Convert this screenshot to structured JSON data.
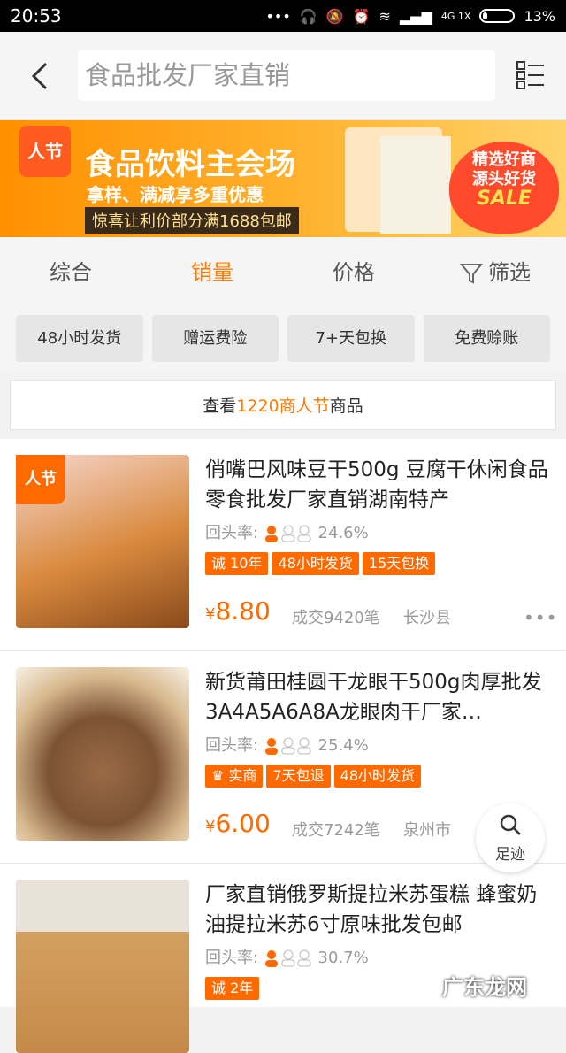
{
  "statusbar": {
    "time": "20:53",
    "signal_text": "4G 1X",
    "battery": "13%"
  },
  "header": {
    "search_placeholder": "食品批发厂家直销"
  },
  "banner": {
    "logo": "人节",
    "title": "食品饮料主会场",
    "subtitle": "拿样、满减享多重优惠",
    "promo": "惊喜让利价部分满1688包邮",
    "badge_line1": "精选好商",
    "badge_line2": "源头好货",
    "badge_sale": "SALE"
  },
  "tabs": [
    {
      "label": "综合",
      "active": false
    },
    {
      "label": "销量",
      "active": true
    },
    {
      "label": "价格",
      "active": false
    },
    {
      "label": "筛选",
      "active": false
    }
  ],
  "filters": [
    "48小时发货",
    "赠运费险",
    "7+天包换",
    "免费赊账"
  ],
  "notice": {
    "prefix": "查看",
    "highlight": "1220商人节",
    "suffix": "商品"
  },
  "products": [
    {
      "ribbon": "人节",
      "title": "俏嘴巴风味豆干500g 豆腐干休闲食品零食批发厂家直销湖南特产",
      "repeat_label": "回头率:",
      "repeat_rate": "24.6%",
      "tags": [
        "诚 10年",
        "48小时发货",
        "15天包换"
      ],
      "price": "8.80",
      "deals": "成交9420笔",
      "region": "长沙县"
    },
    {
      "ribbon": "",
      "title": "新货莆田桂圆干龙眼干500g肉厚批发3A4A5A6A8A龙眼肉干厂家…",
      "repeat_label": "回头率:",
      "repeat_rate": "25.4%",
      "tags": [
        "实商",
        "7天包退",
        "48小时发货"
      ],
      "price": "6.00",
      "deals": "成交7242笔",
      "region": "泉州市"
    },
    {
      "ribbon": "",
      "title": "厂家直销俄罗斯提拉米苏蛋糕 蜂蜜奶油提拉米苏6寸原味批发包邮",
      "repeat_label": "回头率:",
      "repeat_rate": "30.7%",
      "tags": [
        "诚 2年"
      ],
      "price": "",
      "deals": "",
      "region": ""
    }
  ],
  "floating": {
    "zuji": "足迹"
  },
  "watermark": "广东龙网",
  "colors": {
    "accent": "#ff6a00",
    "active_tab": "#ff7a00"
  }
}
